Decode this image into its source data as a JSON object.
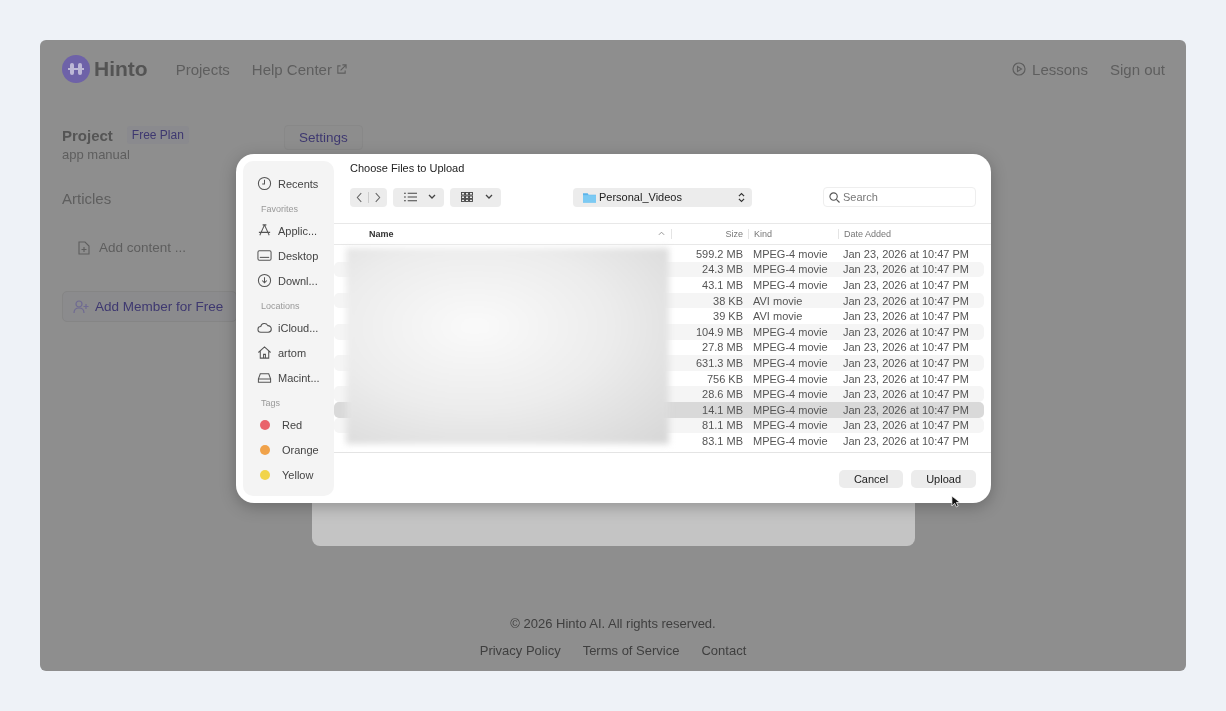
{
  "header": {
    "logo": "Hinto",
    "nav": [
      "Projects",
      "Help Center"
    ],
    "right_nav": [
      "Lessons",
      "Sign out"
    ]
  },
  "project": {
    "title": "Project",
    "plan": "Free Plan",
    "name": "app manual",
    "settings_tab": "Settings",
    "articles": "Articles",
    "add_content": "Add content ...",
    "add_member": "Add Member for Free"
  },
  "footer": {
    "copyright": "© 2026 Hinto AI. All rights reserved.",
    "links": [
      "Privacy Policy",
      "Terms of Service",
      "Contact"
    ]
  },
  "dialog": {
    "title": "Choose Files to Upload",
    "folder": "Personal_Videos",
    "search": {
      "placeholder": "Search"
    },
    "sidebar": [
      {
        "kind": "item",
        "label": "Recents"
      },
      {
        "kind": "heading",
        "label": "Favorites"
      },
      {
        "kind": "item",
        "label": "Applic..."
      },
      {
        "kind": "item",
        "label": "Desktop"
      },
      {
        "kind": "item",
        "label": "Downl..."
      },
      {
        "kind": "heading",
        "label": "Locations"
      },
      {
        "kind": "item",
        "label": "iCloud..."
      },
      {
        "kind": "item",
        "label": "artom"
      },
      {
        "kind": "item",
        "label": "Macint..."
      },
      {
        "kind": "heading",
        "label": "Tags"
      },
      {
        "kind": "tag",
        "color": "#e9636b",
        "label": "Red"
      },
      {
        "kind": "tag",
        "color": "#f0a24a",
        "label": "Orange"
      },
      {
        "kind": "tag",
        "color": "#f2d44a",
        "label": "Yellow"
      }
    ],
    "columns": [
      "Name",
      "Size",
      "Kind",
      "Date Added"
    ],
    "rows": [
      {
        "size": "599.2 MB",
        "kind": "MPEG-4 movie",
        "date": "Jan 23, 2026 at 10:47 PM",
        "selected": false
      },
      {
        "size": "24.3 MB",
        "kind": "MPEG-4 movie",
        "date": "Jan 23, 2026 at 10:47 PM",
        "selected": false
      },
      {
        "size": "43.1 MB",
        "kind": "MPEG-4 movie",
        "date": "Jan 23, 2026 at 10:47 PM",
        "selected": false
      },
      {
        "size": "38 KB",
        "kind": "AVI movie",
        "date": "Jan 23, 2026 at 10:47 PM",
        "selected": false
      },
      {
        "size": "39 KB",
        "kind": "AVI movie",
        "date": "Jan 23, 2026 at 10:47 PM",
        "selected": false
      },
      {
        "size": "104.9 MB",
        "kind": "MPEG-4 movie",
        "date": "Jan 23, 2026 at 10:47 PM",
        "selected": false
      },
      {
        "size": "27.8 MB",
        "kind": "MPEG-4 movie",
        "date": "Jan 23, 2026 at 10:47 PM",
        "selected": false
      },
      {
        "size": "631.3 MB",
        "kind": "MPEG-4 movie",
        "date": "Jan 23, 2026 at 10:47 PM",
        "selected": false
      },
      {
        "size": "756 KB",
        "kind": "MPEG-4 movie",
        "date": "Jan 23, 2026 at 10:47 PM",
        "selected": false
      },
      {
        "size": "28.6 MB",
        "kind": "MPEG-4 movie",
        "date": "Jan 23, 2026 at 10:47 PM",
        "selected": false
      },
      {
        "size": "14.1 MB",
        "kind": "MPEG-4 movie",
        "date": "Jan 23, 2026 at 10:47 PM",
        "selected": true
      },
      {
        "size": "81.1 MB",
        "kind": "MPEG-4 movie",
        "date": "Jan 23, 2026 at 10:47 PM",
        "selected": false
      },
      {
        "size": "83.1 MB",
        "kind": "MPEG-4 movie",
        "date": "Jan 23, 2026 at 10:47 PM",
        "selected": false
      }
    ],
    "buttons": [
      "Cancel",
      "Upload"
    ]
  }
}
